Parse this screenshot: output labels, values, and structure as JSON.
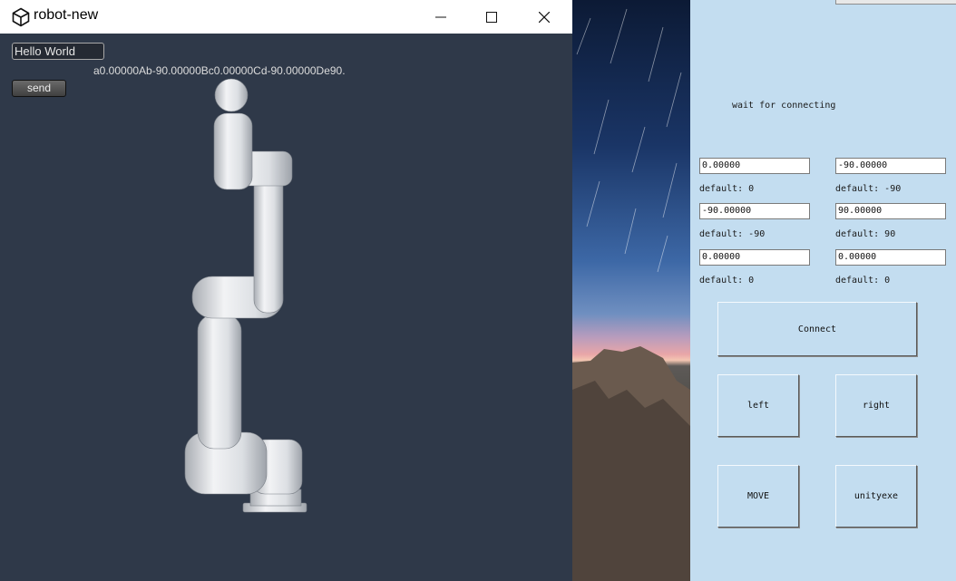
{
  "window": {
    "title": "robot-new",
    "controls": {
      "minimize": "minimize-icon",
      "maximize": "maximize-icon",
      "close": "close-icon"
    }
  },
  "scene": {
    "message_input": {
      "value": "Hello World"
    },
    "send_label": "send",
    "status_text": "a0.00000Ab-90.00000Bc0.00000Cd-90.00000De90."
  },
  "form": {
    "wait_label": "wait for connecting",
    "joints": [
      {
        "value": "0.00000",
        "default": "default: 0"
      },
      {
        "value": "-90.00000",
        "default": "default: -90"
      },
      {
        "value": "-90.00000",
        "default": "default: -90"
      },
      {
        "value": "90.00000",
        "default": "default: 90"
      },
      {
        "value": "0.00000",
        "default": "default: 0"
      },
      {
        "value": "0.00000",
        "default": "default: 0"
      }
    ],
    "buttons": {
      "connect": "Connect",
      "left": "left",
      "right": "right",
      "move": "MOVE",
      "unityexe": "unityexe"
    }
  },
  "colors": {
    "viewport_bg": "#2f3949",
    "form_bg": "#c3ddf0",
    "titlebar_bg": "#ffffff"
  }
}
